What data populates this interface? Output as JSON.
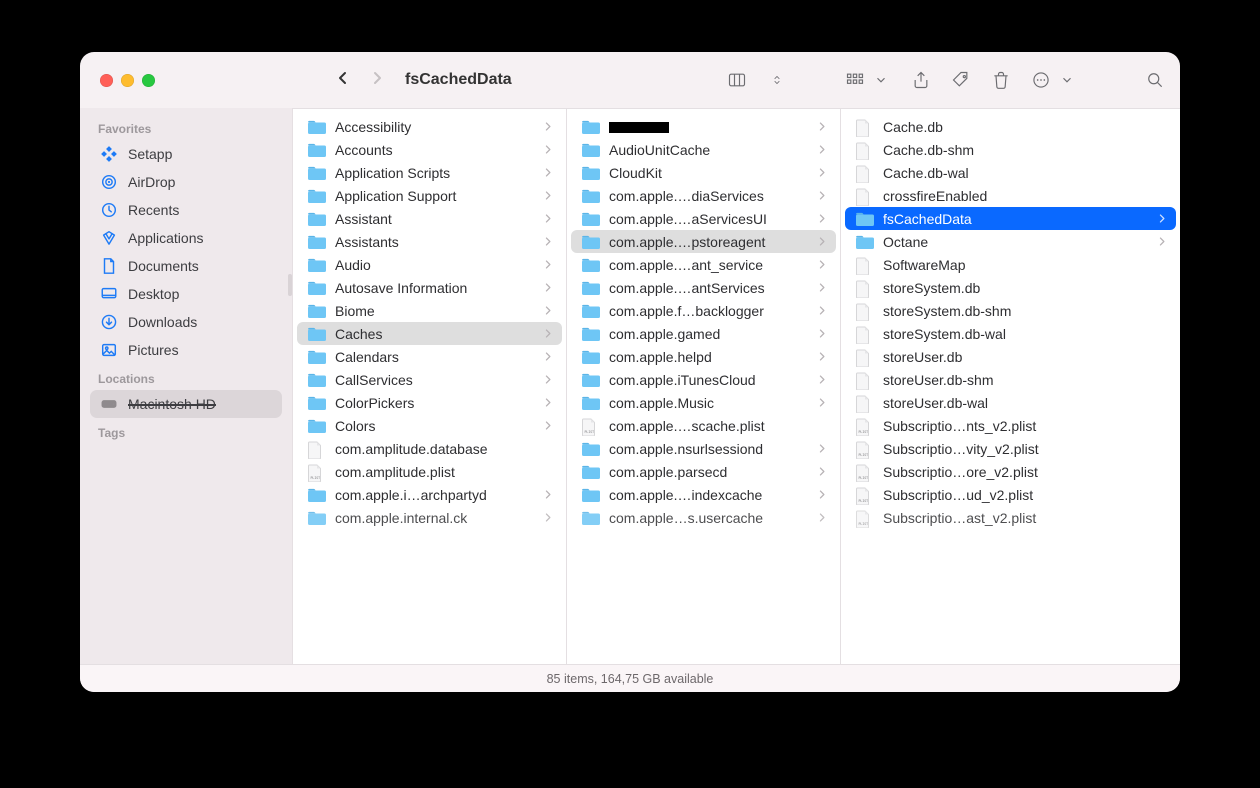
{
  "window": {
    "title": "fsCachedData"
  },
  "statusbar": {
    "text": "85 items, 164,75 GB available"
  },
  "sidebar": {
    "groups": [
      {
        "label": "Favorites",
        "items": [
          {
            "label": "Setapp",
            "icon": "setapp"
          },
          {
            "label": "AirDrop",
            "icon": "airdrop"
          },
          {
            "label": "Recents",
            "icon": "clock"
          },
          {
            "label": "Applications",
            "icon": "apps"
          },
          {
            "label": "Documents",
            "icon": "doc"
          },
          {
            "label": "Desktop",
            "icon": "desktop"
          },
          {
            "label": "Downloads",
            "icon": "download"
          },
          {
            "label": "Pictures",
            "icon": "pictures"
          }
        ]
      },
      {
        "label": "Locations",
        "items": [
          {
            "label": "Macintosh HD",
            "icon": "disk",
            "selected": true,
            "strike": true
          }
        ]
      },
      {
        "label": "Tags",
        "items": []
      }
    ]
  },
  "columns": [
    {
      "selected_index": 10,
      "items": [
        {
          "name": "Accessibility",
          "kind": "folder",
          "has_children": true
        },
        {
          "name": "Accounts",
          "kind": "folder",
          "has_children": true
        },
        {
          "name": "Application Scripts",
          "kind": "folder",
          "has_children": true
        },
        {
          "name": "Application Support",
          "kind": "folder",
          "has_children": true
        },
        {
          "name": "Assistant",
          "kind": "folder",
          "has_children": true
        },
        {
          "name": "Assistants",
          "kind": "folder",
          "has_children": true
        },
        {
          "name": "Audio",
          "kind": "folder",
          "has_children": true
        },
        {
          "name": "Autosave Information",
          "kind": "folder",
          "has_children": true
        },
        {
          "name": "Biome",
          "kind": "folder",
          "has_children": true
        },
        {
          "name": "Caches",
          "kind": "folder",
          "has_children": true
        },
        {
          "name": "Calendars",
          "kind": "folder",
          "has_children": true
        },
        {
          "name": "CallServices",
          "kind": "folder",
          "has_children": true
        },
        {
          "name": "ColorPickers",
          "kind": "folder",
          "has_children": true
        },
        {
          "name": "Colors",
          "kind": "folder",
          "has_children": true
        },
        {
          "name": "com.amplitude.database",
          "kind": "file"
        },
        {
          "name": "com.amplitude.plist",
          "kind": "plist"
        },
        {
          "name": "com.apple.i…archpartyd",
          "kind": "folder",
          "has_children": true
        },
        {
          "name": "com.apple.internal.ck",
          "kind": "folder",
          "has_children": true,
          "cutoff": true
        }
      ]
    },
    {
      "selected_index": 5,
      "items": [
        {
          "name": "",
          "kind": "folder",
          "has_children": true,
          "redacted": true
        },
        {
          "name": "AudioUnitCache",
          "kind": "folder",
          "has_children": true
        },
        {
          "name": "CloudKit",
          "kind": "folder",
          "has_children": true
        },
        {
          "name": "com.apple.…diaServices",
          "kind": "folder",
          "has_children": true
        },
        {
          "name": "com.apple.…aServicesUI",
          "kind": "folder",
          "has_children": true
        },
        {
          "name": "com.apple.…pstoreagent",
          "kind": "folder",
          "has_children": true
        },
        {
          "name": "com.apple.…ant_service",
          "kind": "folder",
          "has_children": true
        },
        {
          "name": "com.apple.…antServices",
          "kind": "folder",
          "has_children": true
        },
        {
          "name": "com.apple.f…backlogger",
          "kind": "folder",
          "has_children": true
        },
        {
          "name": "com.apple.gamed",
          "kind": "folder",
          "has_children": true
        },
        {
          "name": "com.apple.helpd",
          "kind": "folder",
          "has_children": true
        },
        {
          "name": "com.apple.iTunesCloud",
          "kind": "folder",
          "has_children": true
        },
        {
          "name": "com.apple.Music",
          "kind": "folder",
          "has_children": true
        },
        {
          "name": "com.apple.…scache.plist",
          "kind": "plist"
        },
        {
          "name": "com.apple.nsurlsessiond",
          "kind": "folder",
          "has_children": true
        },
        {
          "name": "com.apple.parsecd",
          "kind": "folder",
          "has_children": true
        },
        {
          "name": "com.apple.…indexcache",
          "kind": "folder",
          "has_children": true
        },
        {
          "name": "com.apple…s.usercache",
          "kind": "folder",
          "has_children": true,
          "cutoff": true
        }
      ]
    },
    {
      "selected_index": 4,
      "selection_style": "full",
      "items": [
        {
          "name": "Cache.db",
          "kind": "file"
        },
        {
          "name": "Cache.db-shm",
          "kind": "file"
        },
        {
          "name": "Cache.db-wal",
          "kind": "file"
        },
        {
          "name": "crossfireEnabled",
          "kind": "file"
        },
        {
          "name": "fsCachedData",
          "kind": "folder",
          "has_children": true
        },
        {
          "name": "Octane",
          "kind": "folder",
          "has_children": true
        },
        {
          "name": "SoftwareMap",
          "kind": "file"
        },
        {
          "name": "storeSystem.db",
          "kind": "file"
        },
        {
          "name": "storeSystem.db-shm",
          "kind": "file"
        },
        {
          "name": "storeSystem.db-wal",
          "kind": "file"
        },
        {
          "name": "storeUser.db",
          "kind": "file"
        },
        {
          "name": "storeUser.db-shm",
          "kind": "file"
        },
        {
          "name": "storeUser.db-wal",
          "kind": "file"
        },
        {
          "name": "Subscriptio…nts_v2.plist",
          "kind": "plist"
        },
        {
          "name": "Subscriptio…vity_v2.plist",
          "kind": "plist"
        },
        {
          "name": "Subscriptio…ore_v2.plist",
          "kind": "plist"
        },
        {
          "name": "Subscriptio…ud_v2.plist",
          "kind": "plist"
        },
        {
          "name": "Subscriptio…ast_v2.plist",
          "kind": "plist",
          "cutoff": true
        }
      ]
    }
  ]
}
